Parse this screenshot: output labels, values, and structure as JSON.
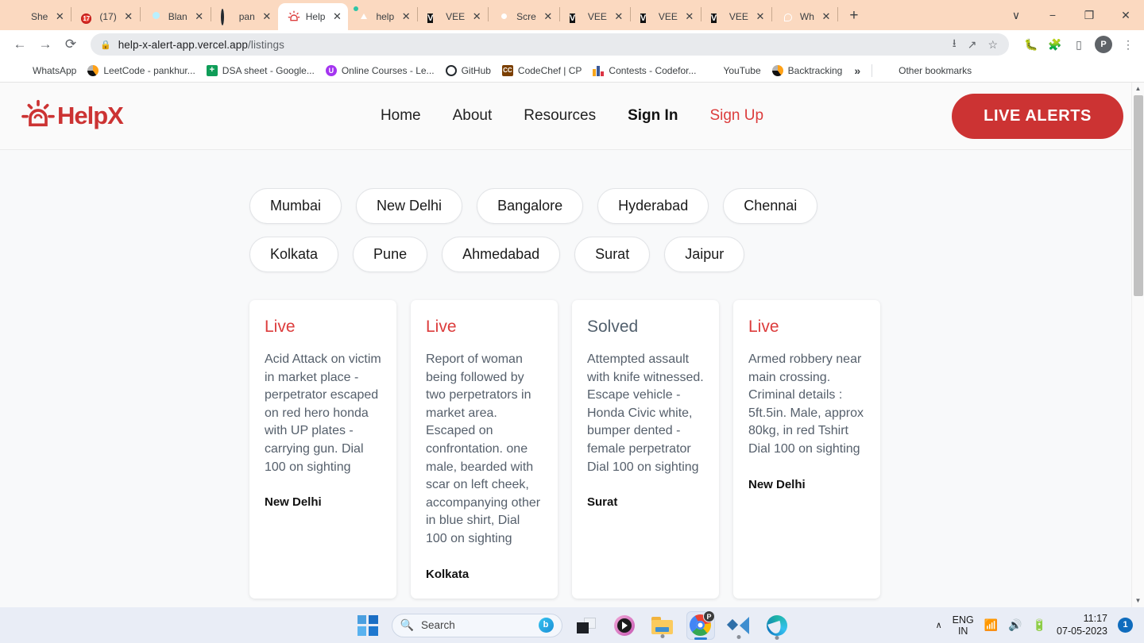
{
  "browser": {
    "tabs": [
      {
        "title": "She",
        "icon": "sheets-icon",
        "active": false
      },
      {
        "title": "(17)",
        "icon": "calendar-icon",
        "active": false
      },
      {
        "title": "Blan",
        "icon": "blank-purple-icon",
        "active": false
      },
      {
        "title": "pan",
        "icon": "github-icon",
        "active": false
      },
      {
        "title": "Help",
        "icon": "helpx-siren-icon",
        "active": true
      },
      {
        "title": "help",
        "icon": "vercel-icon",
        "active": false
      },
      {
        "title": "VEE",
        "icon": "v-icon",
        "active": false
      },
      {
        "title": "Scre",
        "icon": "chrome-icon",
        "active": false
      },
      {
        "title": "VEE",
        "icon": "v-icon",
        "active": false
      },
      {
        "title": "VEE",
        "icon": "v-icon",
        "active": false
      },
      {
        "title": "VEE",
        "icon": "v-icon",
        "active": false
      },
      {
        "title": "Wh",
        "icon": "whatsapp-icon",
        "active": false
      }
    ],
    "new_tab_label": "+",
    "window_controls": [
      "∨",
      "−",
      "❐",
      "✕"
    ],
    "nav": {
      "back": "←",
      "forward": "→",
      "reload": "⟳"
    },
    "omnibox": {
      "lock_icon": "lock-icon",
      "url_host": "help-x-alert-app.vercel.app",
      "url_path": "/listings",
      "actions": [
        "install-icon",
        "share-icon",
        "bookmark-star-icon"
      ]
    },
    "toolbar_right": [
      "extension-bug-icon",
      "extensions-puzzle-icon",
      "side-panel-icon"
    ],
    "profile_initial": "P",
    "menu_icon": "three-dot-menu-icon",
    "bookmarks": [
      {
        "label": "WhatsApp",
        "icon": "whatsapp-icon"
      },
      {
        "label": "LeetCode - pankhur...",
        "icon": "leetcode-icon"
      },
      {
        "label": "DSA sheet - Google...",
        "icon": "google-sheets-icon"
      },
      {
        "label": "Online Courses - Le...",
        "icon": "udemy-icon"
      },
      {
        "label": "GitHub",
        "icon": "github-icon"
      },
      {
        "label": "CodeChef | CP",
        "icon": "codechef-icon"
      },
      {
        "label": "Contests - Codefor...",
        "icon": "codeforces-icon"
      },
      {
        "label": "YouTube",
        "icon": "youtube-icon"
      },
      {
        "label": "Backtracking",
        "icon": "leetcode-icon"
      }
    ],
    "bookmarks_overflow": "»",
    "other_bookmarks": {
      "label": "Other bookmarks",
      "icon": "folder-icon"
    }
  },
  "site": {
    "logo": {
      "text": "HelpX",
      "icon": "siren-alert-icon",
      "color": "#cc3333"
    },
    "nav": [
      {
        "label": "Home",
        "style": "normal"
      },
      {
        "label": "About",
        "style": "normal"
      },
      {
        "label": "Resources",
        "style": "normal"
      },
      {
        "label": "Sign In",
        "style": "bold"
      },
      {
        "label": "Sign Up",
        "style": "red"
      }
    ],
    "cta_label": "LIVE ALERTS",
    "accent_color": "#cc3333",
    "cities": [
      "Mumbai",
      "New Delhi",
      "Bangalore",
      "Hyderabad",
      "Chennai",
      "Kolkata",
      "Pune",
      "Ahmedabad",
      "Surat",
      "Jaipur"
    ],
    "listings": [
      {
        "status": "Live",
        "status_type": "live",
        "description": "Acid Attack on victim in market place - perpetrator escaped on red hero honda with UP plates - carrying gun. Dial 100 on sighting",
        "city": "New Delhi"
      },
      {
        "status": "Live",
        "status_type": "live",
        "description": "Report of woman being followed by two perpetrators in market area. Escaped on confrontation. one male, bearded with scar on left cheek, accompanying other in blue shirt, Dial 100 on sighting",
        "city": "Kolkata"
      },
      {
        "status": "Solved",
        "status_type": "solved",
        "description": "Attempted assault with knife witnessed. Escape vehicle - Honda Civic white, bumper dented - female perpetrator Dial 100 on sighting",
        "city": "Surat"
      },
      {
        "status": "Live",
        "status_type": "live",
        "description": "Armed robbery near main crossing. Criminal details : 5ft.5in. Male, approx 80kg, in red Tshirt Dial 100 on sighting",
        "city": "New Delhi"
      }
    ]
  },
  "taskbar": {
    "start_label": "start-button",
    "search_placeholder": "Search",
    "apps": [
      {
        "name": "task-view",
        "running": false
      },
      {
        "name": "media-player",
        "running": false
      },
      {
        "name": "file-explorer",
        "running": true
      },
      {
        "name": "google-chrome",
        "running": true,
        "active": true,
        "badge": "P"
      },
      {
        "name": "vs-code",
        "running": true
      },
      {
        "name": "microsoft-edge",
        "running": true
      }
    ],
    "tray": {
      "overflow": "∧",
      "language": "ENG",
      "region": "IN",
      "wifi_icon": "wifi-icon",
      "volume_icon": "volume-icon",
      "battery_icon": "battery-charging-icon",
      "time": "11:17",
      "date": "07-05-2023",
      "notification_count": "1"
    }
  }
}
